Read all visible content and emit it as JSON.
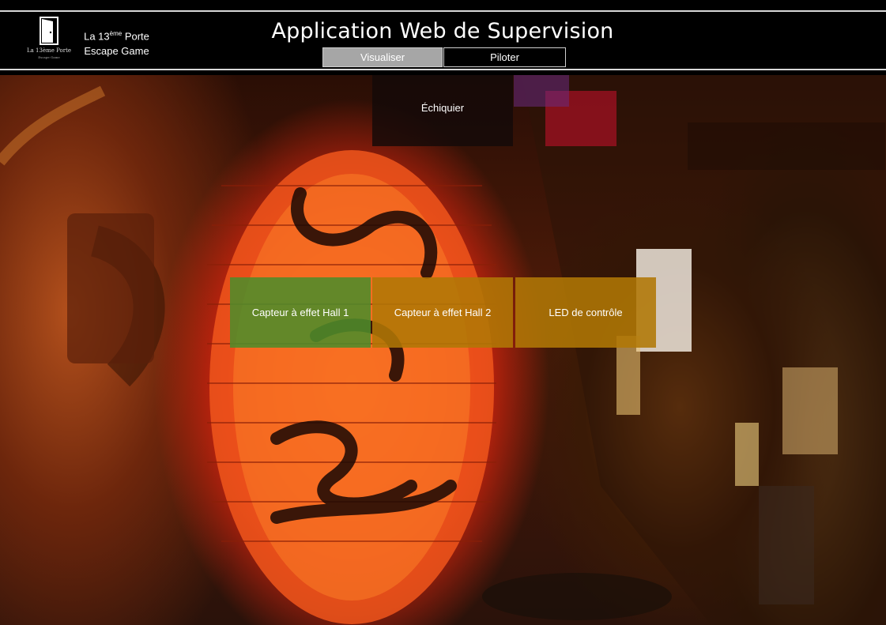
{
  "header": {
    "logo": {
      "text": "La 13ème Porte",
      "subtext": "Escape Game"
    },
    "brand": {
      "line1_prefix": "La 13",
      "line1_sup": "ème",
      "line1_suffix": " Porte",
      "line2": "Escape Game"
    },
    "title": "Application Web de Supervision",
    "tabs": [
      {
        "label": "Visualiser",
        "active": true
      },
      {
        "label": "Piloter",
        "active": false
      }
    ]
  },
  "panels": {
    "echiquier": {
      "label": "Échiquier"
    },
    "hall1": {
      "label": "Capteur à effet Hall 1",
      "color": "#4e8c2a"
    },
    "hall2": {
      "label": "Capteur à effet Hall 2",
      "color": "#b07806"
    },
    "led": {
      "label": "LED de contrôle",
      "color": "#b07806"
    }
  },
  "background": {
    "description_icon": "lantern-alley-photo"
  }
}
